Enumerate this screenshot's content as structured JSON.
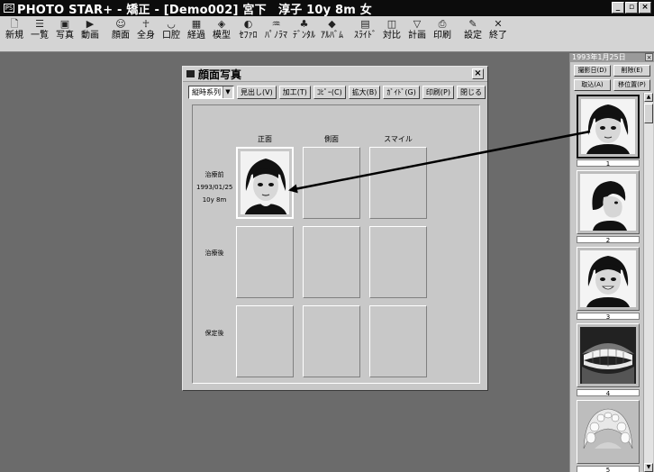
{
  "titlebar": {
    "app_icon": "PS",
    "title": "PHOTO STAR+ - 矯正 - [Demo002]  宮下　淳子  10y 8m  女",
    "controls": {
      "minimize": "_",
      "restore": "▫",
      "close": "×"
    }
  },
  "toolbar": {
    "items": [
      {
        "label": "新規",
        "icon": "new-document-icon",
        "glyph": "🗋"
      },
      {
        "label": "一覧",
        "icon": "list-icon",
        "glyph": "☰"
      },
      {
        "label": "写真",
        "icon": "photo-icon",
        "glyph": "▣"
      },
      {
        "label": "動画",
        "icon": "video-icon",
        "glyph": "▶"
      },
      {
        "label": "顔面",
        "icon": "face-icon",
        "glyph": "☺"
      },
      {
        "label": "全身",
        "icon": "body-icon",
        "glyph": "☥"
      },
      {
        "label": "口腔",
        "icon": "mouth-icon",
        "glyph": "◡"
      },
      {
        "label": "経過",
        "icon": "progress-icon",
        "glyph": "▦"
      },
      {
        "label": "模型",
        "icon": "model-icon",
        "glyph": "◈"
      },
      {
        "label": "ｾﾌｧﾛ",
        "icon": "cephalo-icon",
        "glyph": "◐"
      },
      {
        "label": "ﾊﾟﾉﾗﾏ",
        "icon": "panorama-icon",
        "glyph": "♒"
      },
      {
        "label": "ﾃﾞﾝﾀﾙ",
        "icon": "dental-icon",
        "glyph": "♣"
      },
      {
        "label": "ｱﾙﾊﾞﾑ",
        "icon": "album-icon",
        "glyph": "◆"
      },
      {
        "label": "ｽﾗｲﾄﾞ",
        "icon": "slide-icon",
        "glyph": "▤"
      },
      {
        "label": "対比",
        "icon": "compare-icon",
        "glyph": "◫"
      },
      {
        "label": "計画",
        "icon": "plan-icon",
        "glyph": "▽"
      },
      {
        "label": "印刷",
        "icon": "print-icon",
        "glyph": "⎙"
      },
      {
        "label": "設定",
        "icon": "settings-icon",
        "glyph": "✎"
      },
      {
        "label": "終了",
        "icon": "exit-icon",
        "glyph": "✕"
      }
    ]
  },
  "face_window": {
    "title": "顔面写真",
    "close": "×",
    "buttons": {
      "order_select": "縦時系列",
      "view": "見出し(V)",
      "edit": "加工(T)",
      "copy": "ｺﾋﾟｰ(C)",
      "zoom": "拡大(B)",
      "guide": "ｶﾞｲﾄﾞ(G)",
      "print": "印刷(P)",
      "close": "閉じる"
    },
    "columns": [
      "正面",
      "側面",
      "スマイル"
    ],
    "rows": [
      {
        "label_lines": [
          "治療前",
          "1993/01/25",
          "10y 8m"
        ]
      },
      {
        "label_lines": [
          "治療後"
        ]
      },
      {
        "label_lines": [
          "保定後"
        ]
      }
    ]
  },
  "thumb_panel": {
    "title": "1993年1月25日",
    "close": "×",
    "buttons": {
      "capture_date": "撮影日(D)",
      "delete": "削除(E)",
      "import": "取込(A)",
      "move_position": "移位置(P)"
    },
    "thumbnails": [
      {
        "number": "1",
        "kind": "face-front"
      },
      {
        "number": "2",
        "kind": "face-side"
      },
      {
        "number": "3",
        "kind": "face-smile"
      },
      {
        "number": "4",
        "kind": "intraoral-front"
      },
      {
        "number": "5",
        "kind": "intraoral-occlusal"
      }
    ]
  },
  "colors": {
    "workspace": "#6b6b6b",
    "titlebar": "#0c0c0c",
    "chrome": "#d4d4d4",
    "arrow": "#000000"
  }
}
